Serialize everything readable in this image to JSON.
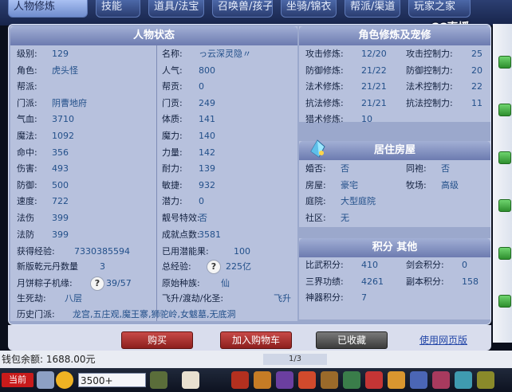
{
  "tabs": [
    "人物修炼",
    "技能",
    "道具/法宝",
    "召唤兽/孩子",
    "坐骑/锦衣",
    "帮派/渠道",
    "玩家之家"
  ],
  "watermark": "CC直播",
  "status": {
    "title": "人物状态",
    "rows": [
      {
        "l1": "级别:",
        "v1": "129",
        "l2": "名称:",
        "v2": "っ云深灵隐〃"
      },
      {
        "l1": "角色:",
        "v1": "虎头怪",
        "l2": "人气:",
        "v2": "800"
      },
      {
        "l1": "帮派:",
        "v1": "",
        "l2": "帮贡:",
        "v2": "0"
      },
      {
        "l1": "门派:",
        "v1": "阴曹地府",
        "l2": "门贡:",
        "v2": "249"
      },
      {
        "l1": "气血:",
        "v1": "3710",
        "l2": "体质:",
        "v2": "141"
      },
      {
        "l1": "魔法:",
        "v1": "1092",
        "l2": "魔力:",
        "v2": "140"
      },
      {
        "l1": "命中:",
        "v1": "356",
        "l2": "力量:",
        "v2": "142"
      },
      {
        "l1": "伤害:",
        "v1": "493",
        "l2": "耐力:",
        "v2": "139"
      },
      {
        "l1": "防御:",
        "v1": "500",
        "l2": "敏捷:",
        "v2": "932"
      },
      {
        "l1": "速度:",
        "v1": "722",
        "l2": "潜力:",
        "v2": "0"
      },
      {
        "l1": "法伤",
        "v1": "399",
        "l2": "靓号特效:",
        "v2": "否"
      },
      {
        "l1": "法防",
        "v1": "399",
        "l2": "成就点数:",
        "v2": "3581"
      }
    ],
    "extra": [
      {
        "l1": "获得经验:",
        "v1": "7330385594",
        "l2": "已用潜能果:",
        "v2": "100"
      },
      {
        "l1": "新版乾元丹数量",
        "v1": "3",
        "l2": "总经验:",
        "v2": "225亿"
      },
      {
        "l1": "月饼粽子机缘:",
        "v1": "39/57",
        "l2": "原始种族:",
        "v2": "仙"
      },
      {
        "l1": "生死劫:",
        "v1": "八层",
        "l2": "飞升/渡劫/化圣:",
        "v2": "飞升"
      }
    ],
    "history_label": "历史门派:",
    "history_value": "龙宫,五庄观,魔王寨,狮驼岭,女魃墓,无底洞"
  },
  "cultivation": {
    "title": "角色修炼及宠修",
    "rows": [
      {
        "l1": "攻击修炼:",
        "v1": "12/20",
        "l2": "攻击控制力:",
        "v2": "25"
      },
      {
        "l1": "防御修炼:",
        "v1": "21/22",
        "l2": "防御控制力:",
        "v2": "20"
      },
      {
        "l1": "法术修炼:",
        "v1": "21/21",
        "l2": "法术控制力:",
        "v2": "22"
      },
      {
        "l1": "抗法修炼:",
        "v1": "21/21",
        "l2": "抗法控制力:",
        "v2": "11"
      },
      {
        "l1": "猎术修炼:",
        "v1": "10",
        "l2": "",
        "v2": ""
      }
    ]
  },
  "house": {
    "title": "居住房屋",
    "rows": [
      {
        "l1": "婚否:",
        "v1": "否",
        "l2": "同袍:",
        "v2": "否"
      },
      {
        "l1": "房屋:",
        "v1": "豪宅",
        "l2": "牧场:",
        "v2": "高级"
      },
      {
        "l1": "庭院:",
        "v1": "大型庭院",
        "l2": "",
        "v2": ""
      },
      {
        "l1": "社区:",
        "v1": "无",
        "l2": "",
        "v2": ""
      }
    ]
  },
  "score": {
    "title": "积分 其他",
    "rows": [
      {
        "l1": "比武积分:",
        "v1": "410",
        "l2": "剑会积分:",
        "v2": "0"
      },
      {
        "l1": "三界功绩:",
        "v1": "4261",
        "l2": "副本积分:",
        "v2": "158"
      },
      {
        "l1": "神器积分:",
        "v1": "7",
        "l2": "",
        "v2": ""
      }
    ]
  },
  "buttons": {
    "buy": "购买",
    "cart": "加入购物车",
    "fav": "已收藏",
    "web": "使用网页版"
  },
  "footer": {
    "money": "钱包余额: 1688.00元",
    "page": "1/3",
    "current": "当前",
    "chat": "3500+"
  }
}
